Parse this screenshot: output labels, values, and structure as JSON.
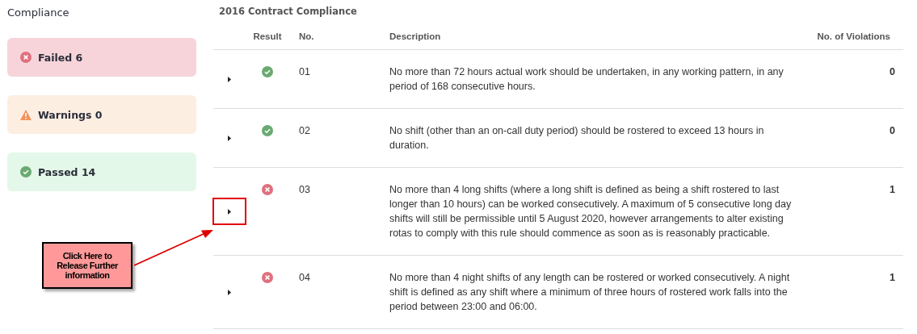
{
  "sidebar": {
    "title": "Compliance",
    "summary": [
      {
        "kind": "failed",
        "label": "Failed 6"
      },
      {
        "kind": "warning",
        "label": "Warnings 0"
      },
      {
        "kind": "passed",
        "label": "Passed 14"
      }
    ]
  },
  "table": {
    "title": "2016 Contract Compliance",
    "columns": [
      "Result",
      "No.",
      "Description",
      "No. of Violations"
    ],
    "rows": [
      {
        "kind": "passed",
        "number": "01",
        "description": "No more than 72 hours actual work should be undertaken, in any working pattern, in any period of 168 consecutive hours.",
        "violations": "0",
        "highlighted": false
      },
      {
        "kind": "passed",
        "number": "02",
        "description": "No shift (other than an on-call duty period) should be rostered to exceed 13 hours in duration.",
        "violations": "0",
        "highlighted": false
      },
      {
        "kind": "failed",
        "number": "03",
        "description": "No more than 4 long shifts (where a long shift is defined as being a shift rostered to last longer than 10 hours) can be worked consecutively. A maximum of 5 consecutive long day shifts will still be permissible until 5 August 2020, however arrangements to alter existing rotas to comply with this rule should commence as soon as is reasonably practicable.",
        "violations": "1",
        "highlighted": true
      },
      {
        "kind": "failed",
        "number": "04",
        "description": "No more than 4 night shifts of any length can be rostered or worked consecutively. A night shift is defined as any shift where a minimum of three hours of rostered work falls into the period between 23:00 and 06:00.",
        "violations": "1",
        "highlighted": false
      }
    ]
  },
  "annotation": {
    "text": "Click Here to Release Further information"
  }
}
